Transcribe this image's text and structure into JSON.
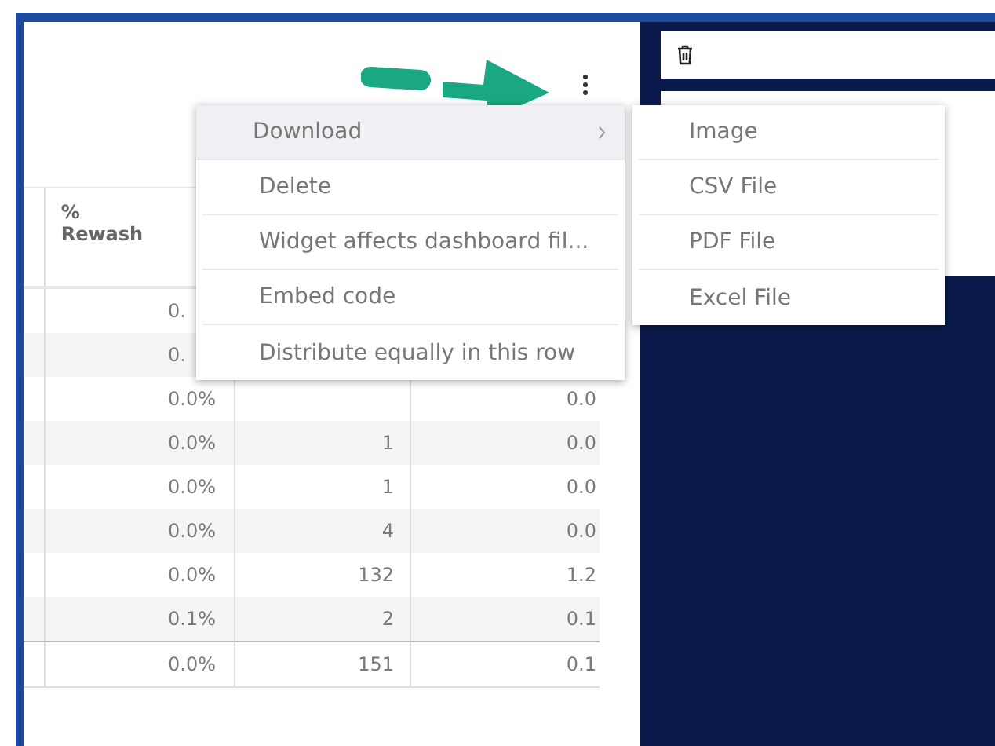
{
  "table": {
    "columns": [
      {
        "label": "%\nRewash"
      }
    ],
    "rows": [
      {
        "rewash": "0.",
        "total": false
      },
      {
        "rewash": "0.",
        "total": false
      },
      {
        "rewash": "0.0%",
        "column_4": "0.0",
        "total": false
      },
      {
        "rewash": "0.0%",
        "column_3": "1",
        "column_4": "0.0",
        "total": false
      },
      {
        "rewash": "0.0%",
        "column_3": "1",
        "column_4": "0.0",
        "total": false
      },
      {
        "rewash": "0.0%",
        "column_3": "4",
        "column_4": "0.0",
        "total": false
      },
      {
        "rewash": "0.0%",
        "column_3": "132",
        "column_4": "1.2",
        "total": false
      },
      {
        "rewash": "0.1%",
        "column_3": "2",
        "column_4": "0.1",
        "total": false
      },
      {
        "rewash": "0.0%",
        "column_3": "151",
        "column_4": "0.1",
        "total": true
      }
    ]
  },
  "menu": {
    "items": [
      {
        "label": "Download",
        "selected": true,
        "submenu": true
      },
      {
        "label": "Delete",
        "selected": false,
        "submenu": false
      },
      {
        "label": "Widget affects dashboard fil...",
        "selected": false,
        "submenu": false
      },
      {
        "label": "Embed code",
        "selected": false,
        "submenu": false
      },
      {
        "label": "Distribute equally in this row",
        "selected": false,
        "submenu": false
      }
    ]
  },
  "submenu": {
    "items": [
      {
        "label": "Image"
      },
      {
        "label": "CSV File"
      },
      {
        "label": "PDF File"
      },
      {
        "label": "Excel File"
      }
    ]
  }
}
